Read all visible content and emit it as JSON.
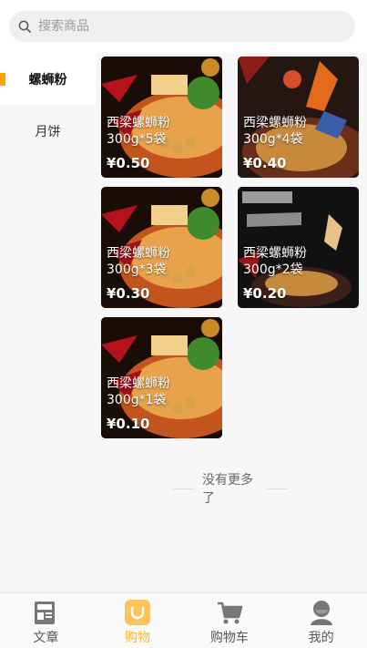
{
  "search": {
    "placeholder": "搜索商品"
  },
  "sidebar": {
    "items": [
      {
        "label": "螺蛳粉",
        "active": true
      },
      {
        "label": "月饼",
        "active": false
      }
    ]
  },
  "products": [
    {
      "title": "西梁螺蛳粉 300g*5袋",
      "price": "¥0.50"
    },
    {
      "title": "西梁螺蛳粉 300g*4袋",
      "price": "¥0.40"
    },
    {
      "title": "西梁螺蛳粉 300g*3袋",
      "price": "¥0.30"
    },
    {
      "title": "西梁螺蛳粉 300g*2袋",
      "price": "¥0.20"
    },
    {
      "title": "西梁螺蛳粉 300g*1袋",
      "price": "¥0.10"
    }
  ],
  "footer_note": "没有更多了",
  "tabbar": {
    "items": [
      {
        "label": "文章",
        "icon": "newspaper-icon"
      },
      {
        "label": "购物",
        "icon": "shopping-bag-icon",
        "active": true
      },
      {
        "label": "购物车",
        "icon": "cart-icon"
      },
      {
        "label": "我的",
        "icon": "user-icon"
      }
    ]
  },
  "colors": {
    "accent": "#ffa200",
    "active_tab": "#ffb53a"
  }
}
